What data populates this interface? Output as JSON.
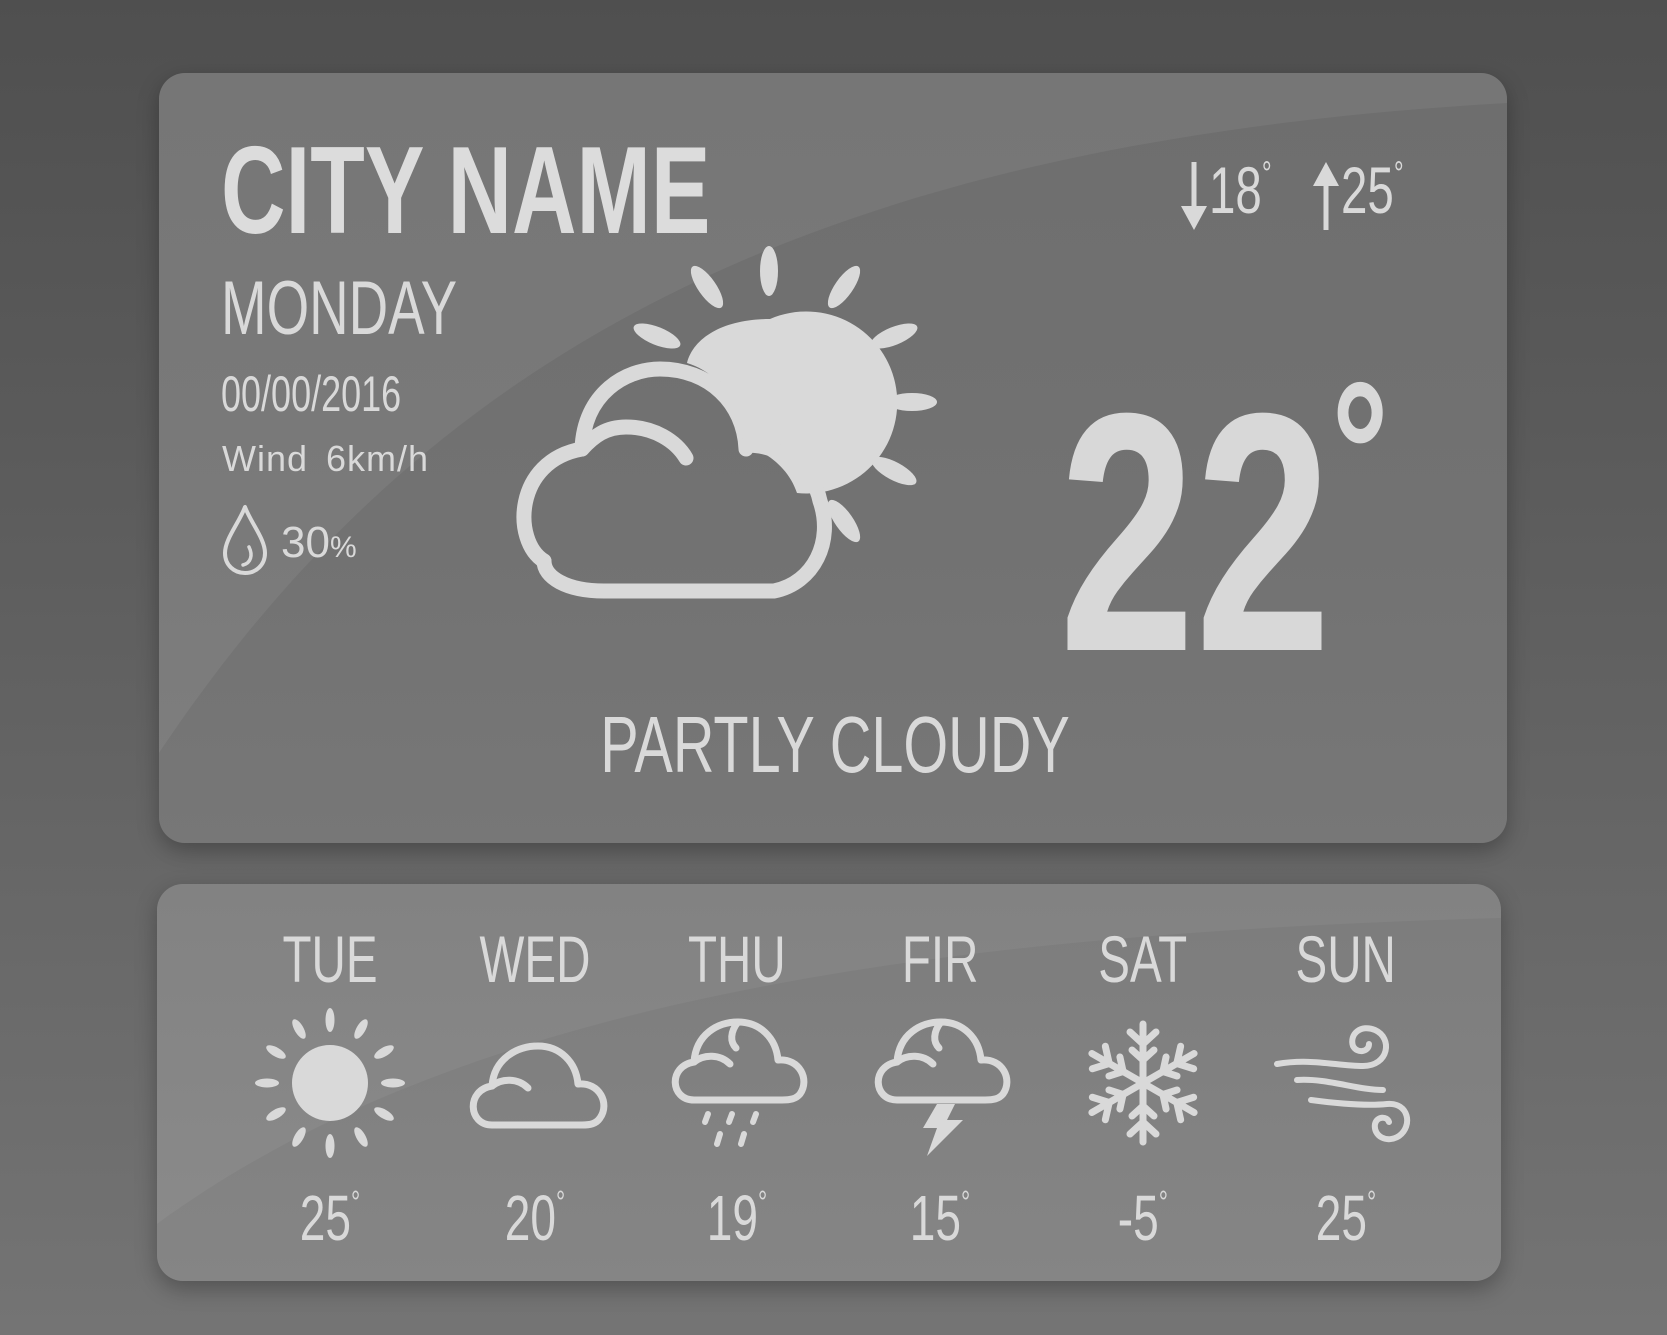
{
  "current": {
    "city": "CITY NAME",
    "day": "MONDAY",
    "date": "00/00/2016",
    "wind_label": "Wind",
    "wind_value": "6km/h",
    "humidity_value": "30",
    "humidity_unit": "%",
    "min_temp": "18",
    "max_temp": "25",
    "degree_symbol": "°",
    "temperature": "22",
    "condition": "PARTLY CLOUDY",
    "icon": "partly-cloudy-icon"
  },
  "forecast": [
    {
      "day": "TUE",
      "temp": "25",
      "icon": "sun-icon"
    },
    {
      "day": "WED",
      "temp": "20",
      "icon": "cloud-icon"
    },
    {
      "day": "THU",
      "temp": "19",
      "icon": "rain-icon"
    },
    {
      "day": "FIR",
      "temp": "15",
      "icon": "thunderstorm-icon"
    },
    {
      "day": "SAT",
      "temp": "-5",
      "icon": "snowflake-icon"
    },
    {
      "day": "SUN",
      "temp": "25",
      "icon": "wind-icon"
    }
  ],
  "colors": {
    "background": "#555555",
    "card": "#727272",
    "text": "#d9d9d9"
  }
}
